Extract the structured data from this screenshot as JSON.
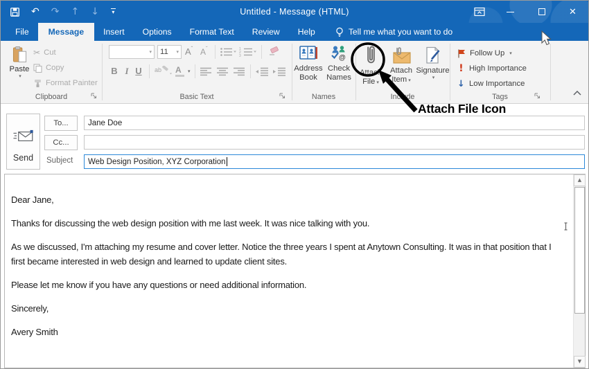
{
  "window": {
    "title": "Untitled  -  Message (HTML)"
  },
  "tabs": {
    "items": [
      {
        "label": "File"
      },
      {
        "label": "Message"
      },
      {
        "label": "Insert"
      },
      {
        "label": "Options"
      },
      {
        "label": "Format Text"
      },
      {
        "label": "Review"
      },
      {
        "label": "Help"
      }
    ],
    "selected": "Message",
    "tell_me_label": "Tell me what you want to do"
  },
  "ribbon": {
    "clipboard": {
      "group_label": "Clipboard",
      "paste_label": "Paste",
      "cut_label": "Cut",
      "copy_label": "Copy",
      "format_painter_label": "Format Painter"
    },
    "basic_text": {
      "group_label": "Basic Text",
      "font_name_value": "",
      "font_size_value": "11",
      "bold_glyph": "B",
      "italic_glyph": "I",
      "underline_glyph": "U"
    },
    "names": {
      "group_label": "Names",
      "address_book_line1": "Address",
      "address_book_line2": "Book",
      "check_names_line1": "Check",
      "check_names_line2": "Names"
    },
    "include": {
      "group_label": "Include",
      "attach_file_line1": "Attach",
      "attach_file_line2": "File",
      "attach_item_line1": "Attach",
      "attach_item_line2": "Item",
      "signature_label": "Signature"
    },
    "tags": {
      "group_label": "Tags",
      "follow_up_label": "Follow Up",
      "high_importance_label": "High Importance",
      "low_importance_label": "Low Importance",
      "high_importance_glyph": "!",
      "low_importance_glyph": "↓"
    }
  },
  "annotation": {
    "label": "Attach File Icon"
  },
  "compose": {
    "send_label": "Send",
    "to_button_label": "To...",
    "cc_button_label": "Cc...",
    "subject_label": "Subject",
    "to_value": "Jane Doe",
    "cc_value": "",
    "subject_value": "Web Design Position, XYZ Corporation"
  },
  "message_body": {
    "paragraphs": [
      "Dear Jane,",
      "Thanks for discussing the web design position with me last week. It was nice talking with you.",
      "As we discussed, I'm attaching my resume and cover letter. Notice the three years I spent at Anytown Consulting. It was in that position that I first became interested in web design and learned to update client sites.",
      "Please let me know if you have any questions or need additional information.",
      "Sincerely,",
      "Avery Smith"
    ]
  },
  "glyphs": {
    "dropdown_caret": "▾",
    "undo": "↶",
    "redo": "↷",
    "move_up": "↑",
    "move_down": "↓",
    "minimize": "–",
    "close": "✕",
    "scissors": "✂",
    "scroll_up": "▲",
    "scroll_down": "▼"
  },
  "colors": {
    "titlebar_blue": "#1467b8",
    "focus_border_blue": "#2b88d8",
    "flag_red": "#d0451b",
    "importance_red": "#cf3a1c",
    "importance_blue": "#2e62a8",
    "annotation_black": "#000000"
  }
}
